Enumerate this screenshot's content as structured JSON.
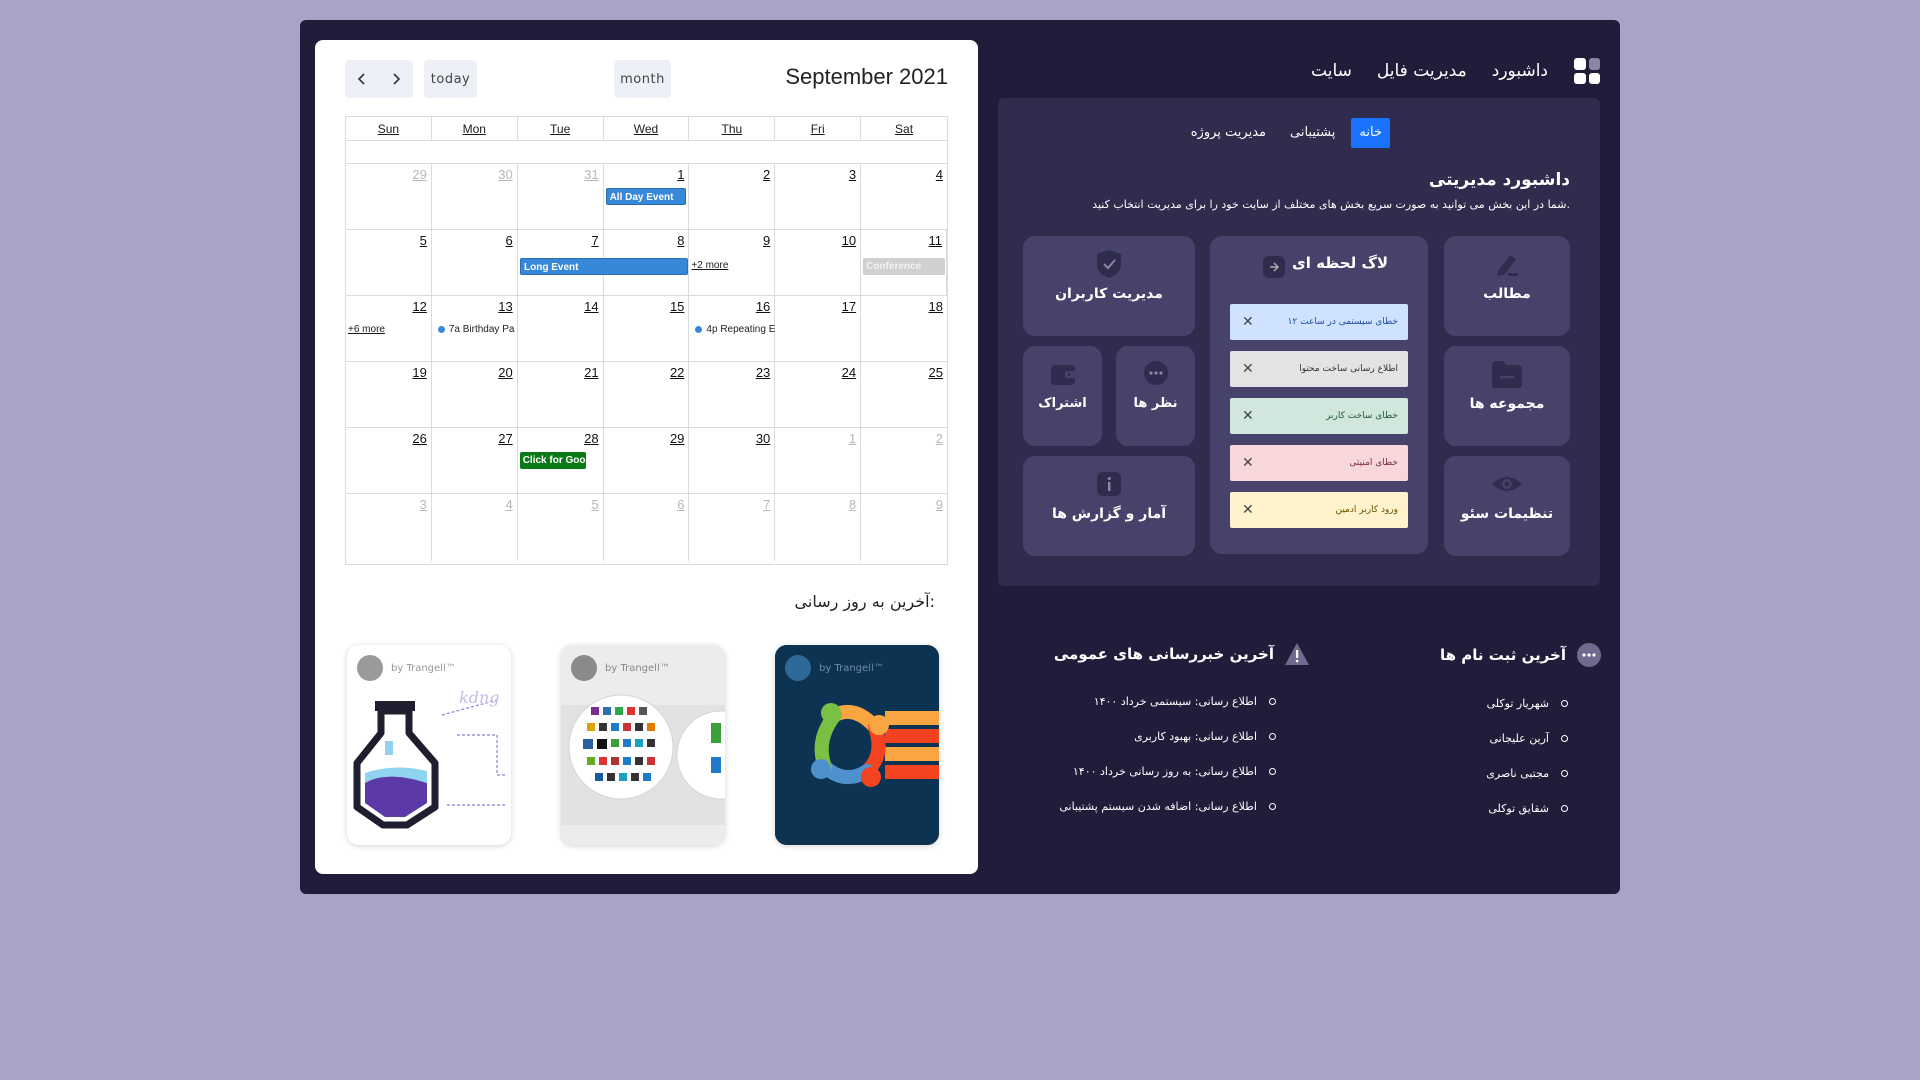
{
  "calendar": {
    "title": "September 2021",
    "today_label": "today",
    "month_label": "month",
    "weekdays": [
      "Sun",
      "Mon",
      "Tue",
      "Wed",
      "Thu",
      "Fri",
      "Sat"
    ],
    "weeks": [
      [
        "29",
        "30",
        "31",
        "1",
        "2",
        "3",
        "4"
      ],
      [
        "5",
        "6",
        "7",
        "8",
        "9",
        "10",
        "11"
      ],
      [
        "12",
        "13",
        "14",
        "15",
        "16",
        "17",
        "18"
      ],
      [
        "19",
        "20",
        "21",
        "22",
        "23",
        "24",
        "25"
      ],
      [
        "26",
        "27",
        "28",
        "29",
        "30",
        "1",
        "2"
      ],
      [
        "3",
        "4",
        "5",
        "6",
        "7",
        "8",
        "9"
      ]
    ],
    "events": {
      "all_day": "All Day Event",
      "long": "Long Event",
      "more_2": "+2 more",
      "conference": "Conference",
      "more_6": "+6 more",
      "birthday": "7a Birthday Pa",
      "repeating": "4p Repeating E",
      "google": "Click for Google"
    }
  },
  "updates": {
    "title": "آخرین به روز رسانی:",
    "brand": "by Trangell™"
  },
  "topnav": {
    "items": [
      "داشبورد",
      "مدیریت فایل",
      "سایت"
    ]
  },
  "dashboard": {
    "tabs": [
      "خانه",
      "پشتیبانی",
      "مدیریت پروژه"
    ],
    "title": "داشبورد مدیریتی",
    "subtitle": "شما در این بخش می توانید به صورت سریع بخش های مختلف از سایت خود را برای مدیریت انتخاب کنید.",
    "tiles": {
      "articles": "مطالب",
      "collections": "مجموعه ها",
      "seo": "تنظیمات سئو",
      "users": "مدیریت کاربران",
      "comments": "نظر ها",
      "subscription": "اشتراک",
      "stats": "آمار و گزارش ها"
    },
    "log": {
      "title": "لاگ لحظه ای",
      "items": [
        {
          "text": "خطای سیستمی در ساعت ۱۲",
          "color": "#cfe2ff",
          "fg": "#1a4a9a"
        },
        {
          "text": "اطلاع رسانی ساخت محتوا",
          "color": "#e2e3e5",
          "fg": "#333333"
        },
        {
          "text": "خطای ساخت کاربر",
          "color": "#d1e7dd",
          "fg": "#1f5a3a"
        },
        {
          "text": "خطای امنیتی",
          "color": "#f8d7da",
          "fg": "#7a2a30"
        },
        {
          "text": "ورود کاربر ادمین",
          "color": "#fff3cd",
          "fg": "#6a5200"
        }
      ]
    }
  },
  "registrations": {
    "title": "آخرین ثبت نام ها",
    "items": [
      "شهریار توکلی",
      "آرین علیجانی",
      "مجتبی ناصری",
      "شقایق توکلی"
    ]
  },
  "news": {
    "title": "آخرین خبررسانی های عمومی",
    "items": [
      "اطلاع رسانی: سیستمی خرداد ۱۴۰۰",
      "اطلاع رسانی: بهبود کاربری",
      "اطلاع رسانی: به روز رسانی خرداد ۱۴۰۰",
      "اطلاع رسانی: اضافه شدن سیستم پشتیبانی"
    ]
  }
}
